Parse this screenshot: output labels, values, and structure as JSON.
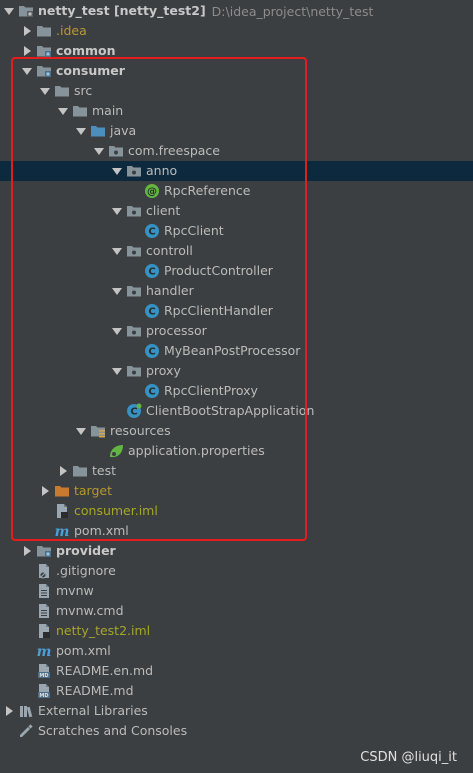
{
  "tree": [
    {
      "label": "netty_test [netty_test2]",
      "suffix": "D:\\idea_project\\netty_test",
      "icon": "project-folder-icon",
      "expanded": true,
      "level": 0,
      "bold": true
    },
    {
      "label": ".idea",
      "icon": "folder-icon",
      "expanded": false,
      "level": 1,
      "color": "idea"
    },
    {
      "label": "common",
      "icon": "module-folder-icon",
      "expanded": false,
      "level": 1,
      "bold": true
    },
    {
      "label": "consumer",
      "icon": "module-folder-icon",
      "expanded": true,
      "level": 1,
      "bold": true
    },
    {
      "label": "src",
      "icon": "folder-icon",
      "expanded": true,
      "level": 2
    },
    {
      "label": "main",
      "icon": "folder-icon",
      "expanded": true,
      "level": 3
    },
    {
      "label": "java",
      "icon": "source-folder-icon",
      "expanded": true,
      "level": 4
    },
    {
      "label": "com.freespace",
      "icon": "package-icon",
      "expanded": true,
      "level": 5
    },
    {
      "label": "anno",
      "icon": "package-icon",
      "expanded": true,
      "level": 6,
      "selected": true
    },
    {
      "label": "RpcReference",
      "icon": "annotation-icon",
      "level": 7
    },
    {
      "label": "client",
      "icon": "package-icon",
      "expanded": true,
      "level": 6
    },
    {
      "label": "RpcClient",
      "icon": "class-icon",
      "level": 7
    },
    {
      "label": "controll",
      "icon": "package-icon",
      "expanded": true,
      "level": 6
    },
    {
      "label": "ProductController",
      "icon": "class-icon",
      "level": 7
    },
    {
      "label": "handler",
      "icon": "package-icon",
      "expanded": true,
      "level": 6
    },
    {
      "label": "RpcClientHandler",
      "icon": "class-icon",
      "level": 7
    },
    {
      "label": "processor",
      "icon": "package-icon",
      "expanded": true,
      "level": 6
    },
    {
      "label": "MyBeanPostProcessor",
      "icon": "class-icon",
      "level": 7
    },
    {
      "label": "proxy",
      "icon": "package-icon",
      "expanded": true,
      "level": 6
    },
    {
      "label": "RpcClientProxy",
      "icon": "class-icon",
      "level": 7
    },
    {
      "label": "ClientBootStrapApplication",
      "icon": "spring-class-icon",
      "level": 6
    },
    {
      "label": "resources",
      "icon": "resources-folder-icon",
      "expanded": true,
      "level": 4
    },
    {
      "label": "application.properties",
      "icon": "spring-properties-icon",
      "level": 5
    },
    {
      "label": "test",
      "icon": "folder-icon",
      "expanded": false,
      "level": 3
    },
    {
      "label": "target",
      "icon": "excluded-folder-icon",
      "expanded": false,
      "level": 2,
      "color": "target"
    },
    {
      "label": "consumer.iml",
      "icon": "iml-file-icon",
      "level": 2,
      "color": "yellow"
    },
    {
      "label": "pom.xml",
      "icon": "maven-icon",
      "level": 2
    },
    {
      "label": "provider",
      "icon": "module-folder-icon",
      "expanded": false,
      "level": 1,
      "bold": true
    },
    {
      "label": ".gitignore",
      "icon": "gitignore-file-icon",
      "level": 1
    },
    {
      "label": "mvnw",
      "icon": "text-file-icon",
      "level": 1
    },
    {
      "label": "mvnw.cmd",
      "icon": "text-file-icon",
      "level": 1
    },
    {
      "label": "netty_test2.iml",
      "icon": "iml-file-icon",
      "level": 1,
      "color": "yellow"
    },
    {
      "label": "pom.xml",
      "icon": "maven-icon",
      "level": 1
    },
    {
      "label": "README.en.md",
      "icon": "markdown-file-icon",
      "level": 1
    },
    {
      "label": "README.md",
      "icon": "markdown-file-icon",
      "level": 1
    },
    {
      "label": "External Libraries",
      "icon": "libraries-icon",
      "expanded": false,
      "level": 0
    },
    {
      "label": "Scratches and Consoles",
      "icon": "scratches-icon",
      "level": 0
    }
  ],
  "watermark": "CSDN @liuqi_it",
  "colors": {
    "background": "#3c3f41",
    "selection": "#0d293e",
    "highlight_box": "#e51c1c",
    "folder": "#87939a",
    "class_circle": "#3592c4",
    "annotation_circle": "#62b543"
  }
}
